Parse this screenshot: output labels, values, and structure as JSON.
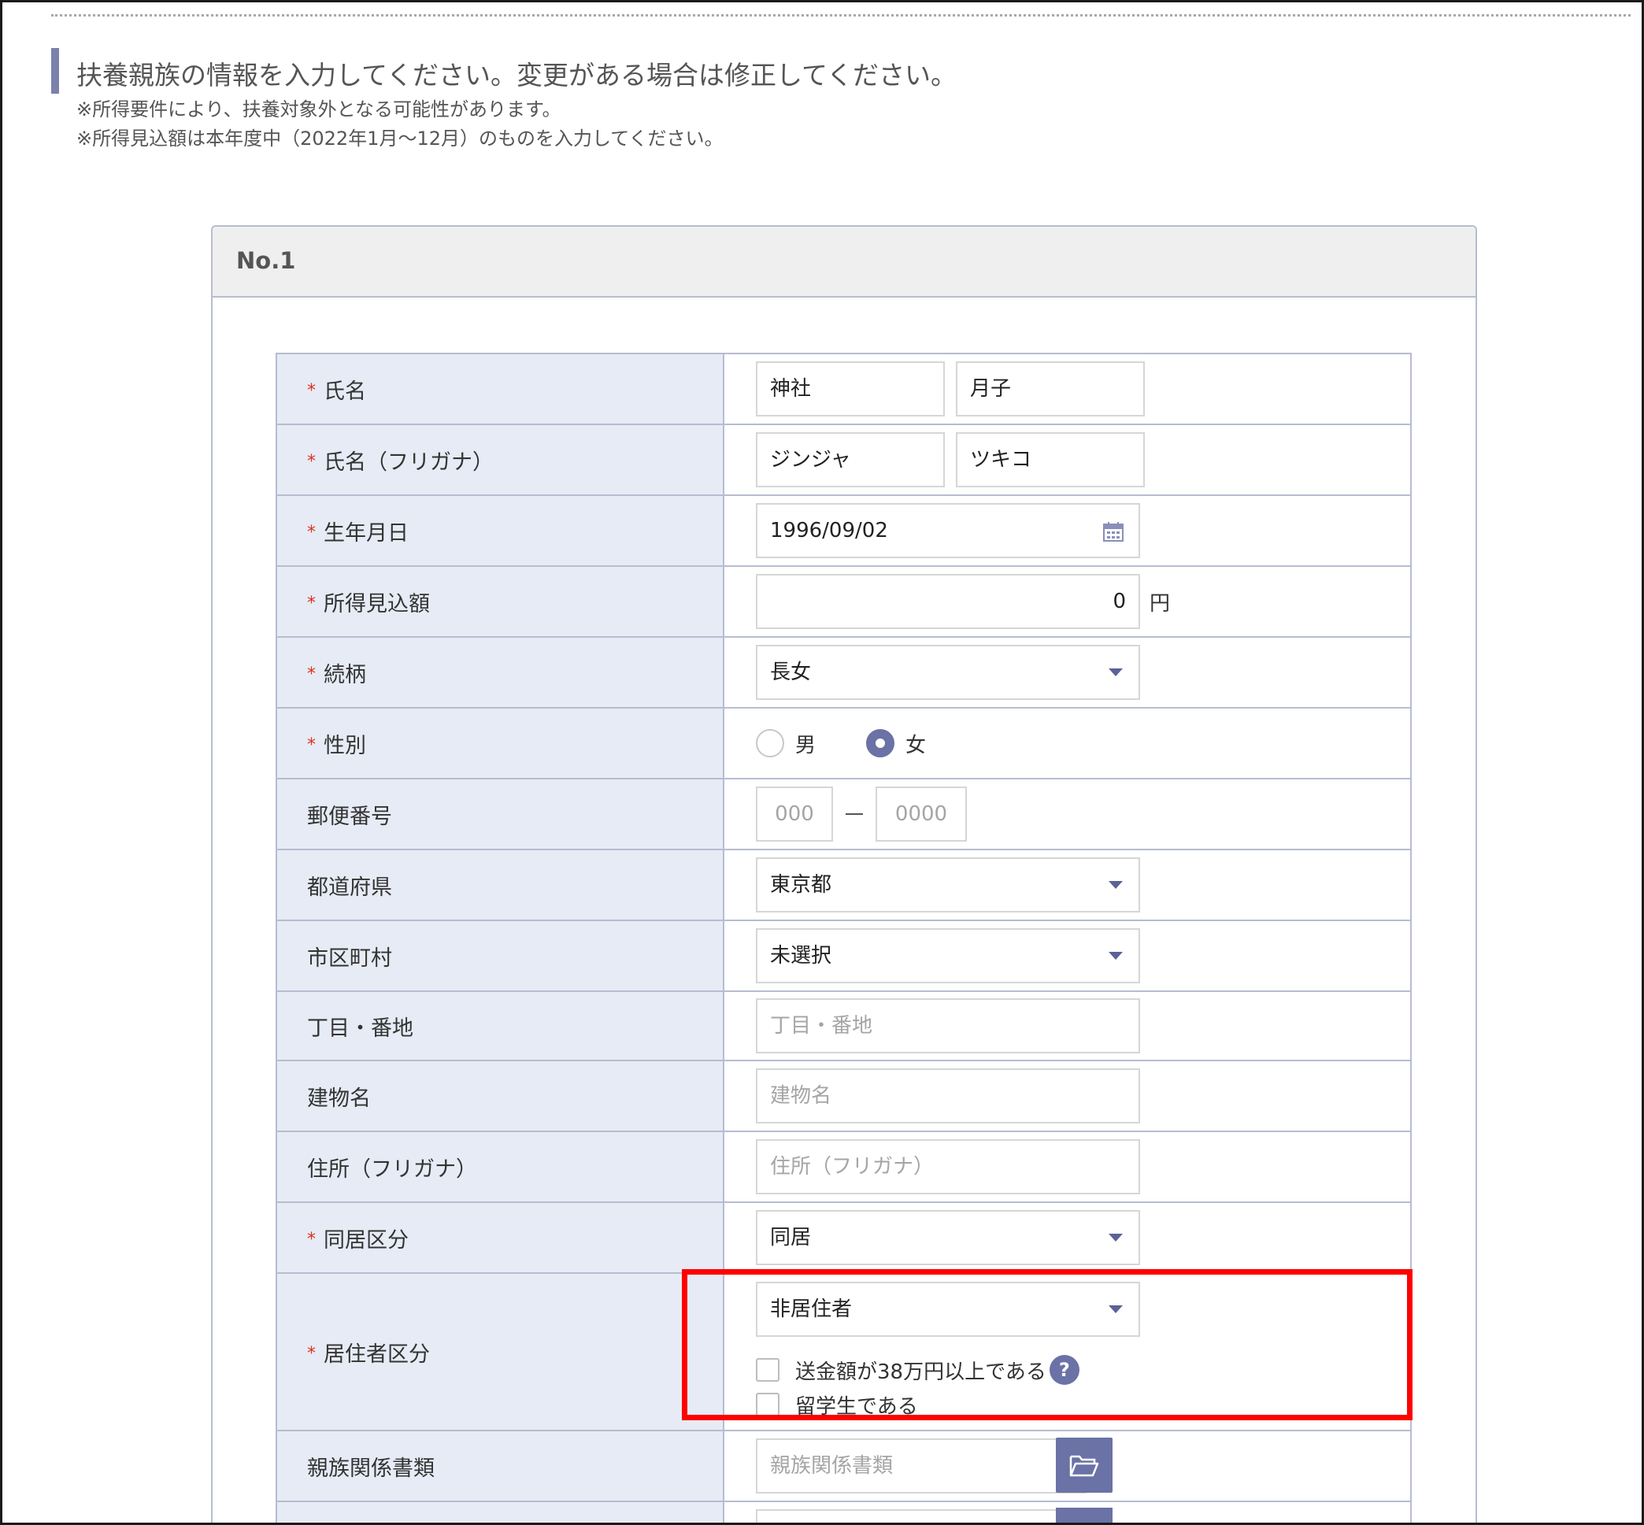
{
  "notice": {
    "main": "扶養親族の情報を入力してください。変更がある場合は修正してください。",
    "sub1": "※所得要件により、扶養対象外となる可能性があります。",
    "sub2": "※所得見込額は本年度中（2022年1月～12月）のものを入力してください。"
  },
  "panel": {
    "title": "No.1"
  },
  "form": {
    "required_mark": "*",
    "name": {
      "label": "氏名",
      "last": "神社",
      "first": "月子"
    },
    "kana": {
      "label": "氏名（フリガナ）",
      "last": "ジンジャ",
      "first": "ツキコ"
    },
    "birth": {
      "label": "生年月日",
      "value": "1996/09/02"
    },
    "income": {
      "label": "所得見込額",
      "value": "0",
      "unit": "円"
    },
    "relation": {
      "label": "続柄",
      "value": "長女"
    },
    "gender": {
      "label": "性別",
      "options": [
        "男",
        "女"
      ],
      "selected": "女"
    },
    "postal": {
      "label": "郵便番号",
      "placeholder1": "000",
      "placeholder2": "0000"
    },
    "prefecture": {
      "label": "都道府県",
      "value": "東京都"
    },
    "city": {
      "label": "市区町村",
      "value": "未選択"
    },
    "street": {
      "label": "丁目・番地",
      "placeholder": "丁目・番地"
    },
    "building": {
      "label": "建物名",
      "placeholder": "建物名"
    },
    "address_kana": {
      "label": "住所（フリガナ）",
      "placeholder": "住所（フリガナ）"
    },
    "cohabitation": {
      "label": "同居区分",
      "value": "同居"
    },
    "residency": {
      "label": "居住者区分",
      "value": "非居住者",
      "check1": "送金額が38万円以上である",
      "check2": "留学生である",
      "help": "?"
    },
    "relation_doc": {
      "label": "親族関係書類",
      "placeholder": "親族関係書類"
    }
  },
  "colors": {
    "accent": "#6a72a6",
    "label_bg": "#e6ebf5",
    "highlight": "#ff0000",
    "required": "#e0301e"
  }
}
